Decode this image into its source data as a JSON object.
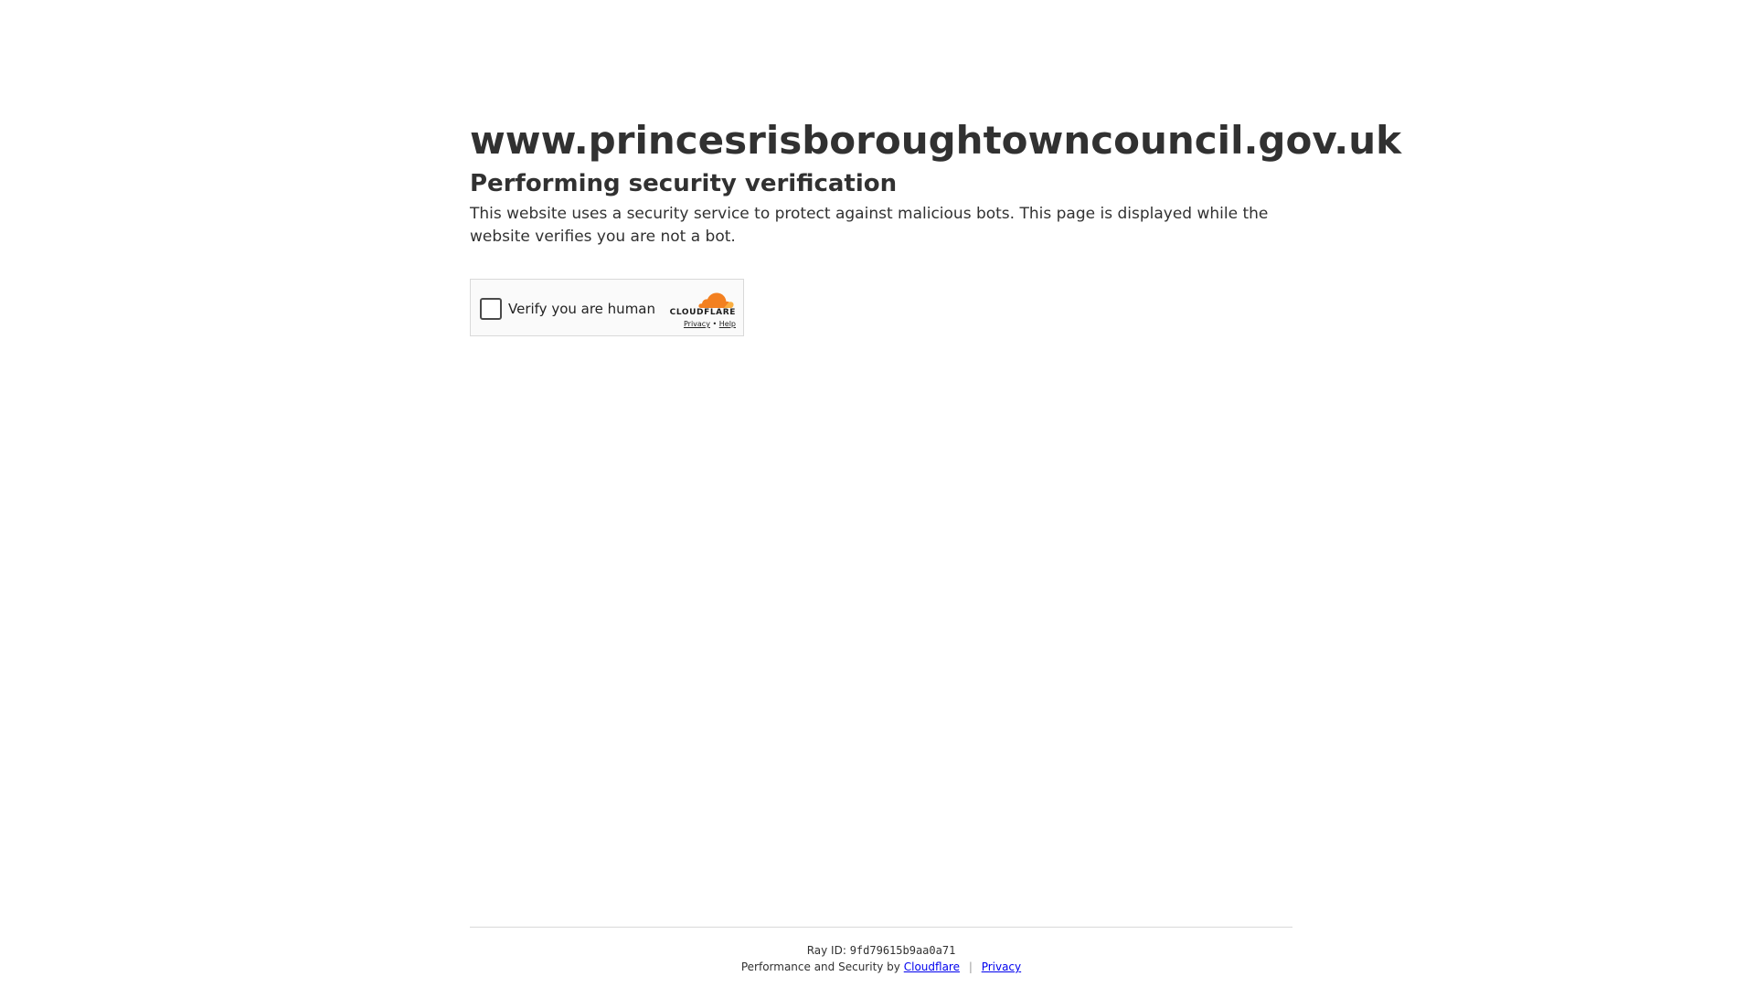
{
  "domain": "www.princesrisboroughtowncouncil.gov.uk",
  "headline": "Performing security verification",
  "description": "This website uses a security service to protect against malicious bots. This page is displayed while the website verifies you are not a bot.",
  "widget": {
    "label": "Verify you are human",
    "brand_name": "CLOUDFLARE",
    "privacy_link": "Privacy",
    "links_separator": "•",
    "help_link": "Help",
    "cloud_icon": "cloudflare-cloud-icon",
    "brand_orange": "#f38020",
    "brand_light_orange": "#faae40"
  },
  "footer": {
    "ray_label": "Ray ID:",
    "ray_id": "9fd79615b9aa0a71",
    "perf_text": "Performance and Security by",
    "cloudflare_link": "Cloudflare",
    "separator": "|",
    "privacy_link": "Privacy",
    "link_color": "#0000ee"
  }
}
